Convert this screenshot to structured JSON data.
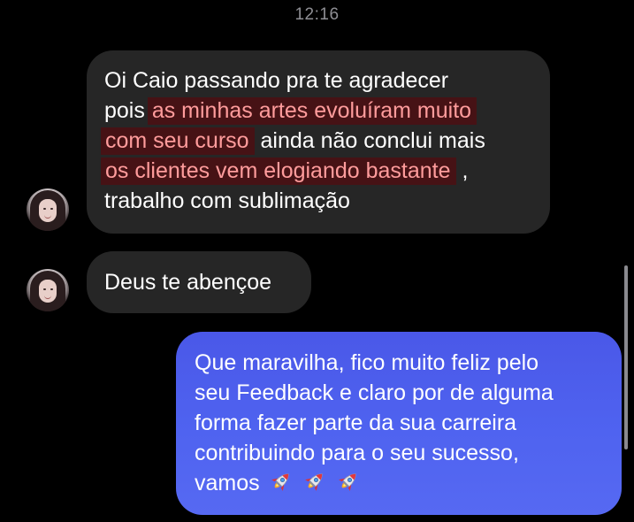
{
  "status": {
    "time": "12:16"
  },
  "messages": [
    {
      "direction": "incoming",
      "lines": [
        {
          "parts": [
            {
              "text": "Oi Caio passando pra te agradecer",
              "highlight": false
            }
          ]
        },
        {
          "parts": [
            {
              "text": "pois ",
              "highlight": false
            },
            {
              "text": "as minhas artes evoluíram muito",
              "highlight": true
            }
          ]
        },
        {
          "parts": [
            {
              "text": "com seu curso",
              "highlight": true
            },
            {
              "text": " ainda não conclui mais",
              "highlight": false
            }
          ]
        },
        {
          "parts": [
            {
              "text": "os clientes vem elogiando bastante",
              "highlight": true
            },
            {
              "text": " ,",
              "highlight": false
            }
          ]
        },
        {
          "parts": [
            {
              "text": "trabalho com sublimação",
              "highlight": false
            }
          ]
        }
      ]
    },
    {
      "direction": "incoming",
      "text": "Deus te abençoe"
    },
    {
      "direction": "outgoing",
      "lines": [
        "Que maravilha, fico muito feliz pelo",
        "seu Feedback e claro por de alguma",
        "forma fazer parte da sua carreira",
        "contribuindo para o seu sucesso,",
        "vamos"
      ],
      "emoji": [
        "rocket-icon",
        "rocket-icon",
        "rocket-icon"
      ]
    }
  ],
  "colors": {
    "background": "#000000",
    "incoming_bubble": "#262626",
    "outgoing_bubble": "#4f63f0",
    "highlight_bg": "#461215",
    "highlight_text": "#ff9c9c",
    "timestamp": "#8e8e93"
  }
}
